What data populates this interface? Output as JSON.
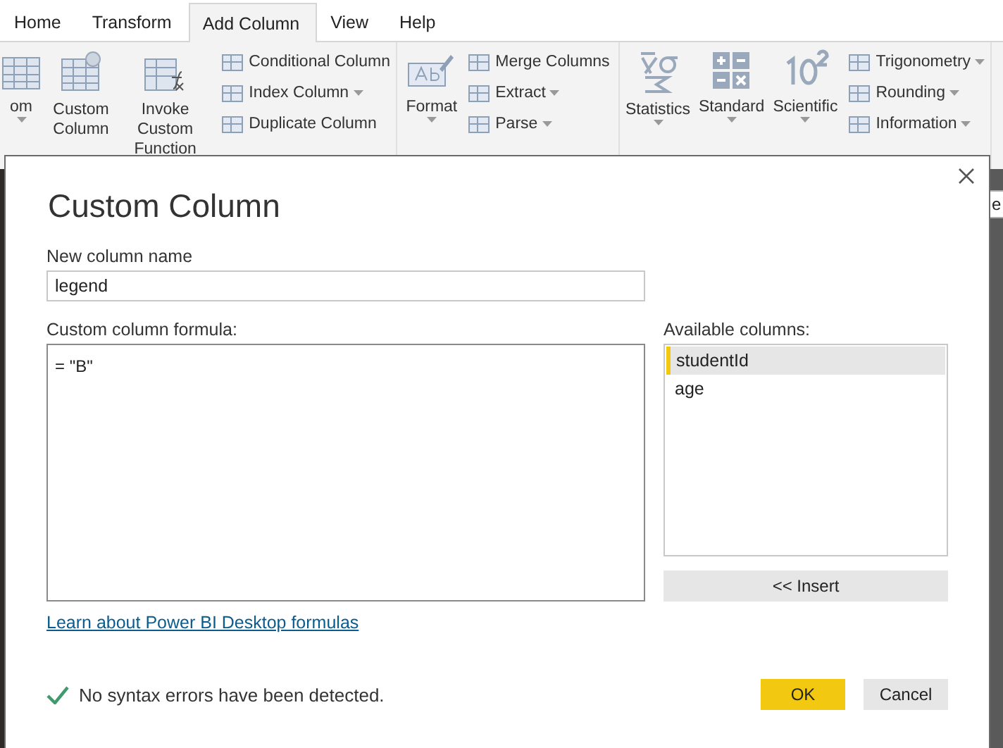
{
  "tabs": [
    {
      "label": "Home",
      "selected": false
    },
    {
      "label": "Transform",
      "selected": false
    },
    {
      "label": "Add Column",
      "selected": true
    },
    {
      "label": "View",
      "selected": false
    },
    {
      "label": "Help",
      "selected": false
    }
  ],
  "ribbon": {
    "groups": [
      {
        "items": [
          {
            "kind": "large",
            "label": "om",
            "dropdown": true
          },
          {
            "kind": "large",
            "label": "Custom Column",
            "dropdown": false
          },
          {
            "kind": "large",
            "label": "Invoke Custom Function",
            "dropdown": false
          },
          {
            "kind": "small",
            "label": "Conditional Column",
            "dropdown": false
          },
          {
            "kind": "small",
            "label": "Index Column",
            "dropdown": true
          },
          {
            "kind": "small",
            "label": "Duplicate Column",
            "dropdown": false
          }
        ]
      },
      {
        "items": [
          {
            "kind": "large",
            "label": "Format",
            "dropdown": true
          },
          {
            "kind": "small",
            "label": "Merge Columns",
            "dropdown": false
          },
          {
            "kind": "small",
            "label": "Extract",
            "dropdown": true
          },
          {
            "kind": "small",
            "label": "Parse",
            "dropdown": true
          }
        ]
      },
      {
        "items": [
          {
            "kind": "large",
            "label": "Statistics",
            "dropdown": true
          },
          {
            "kind": "large",
            "label": "Standard",
            "dropdown": true
          },
          {
            "kind": "large",
            "label": "Scientific",
            "dropdown": true
          },
          {
            "kind": "small",
            "label": "Trigonometry",
            "dropdown": true
          },
          {
            "kind": "small",
            "label": "Rounding",
            "dropdown": true
          },
          {
            "kind": "small",
            "label": "Information",
            "dropdown": true
          }
        ]
      }
    ]
  },
  "side_field": {
    "value": "e"
  },
  "dialog": {
    "title": "Custom Column",
    "name_label": "New column name",
    "name_value": "legend",
    "formula_label": "Custom column formula:",
    "formula": "= \"B\"",
    "columns_label": "Available columns:",
    "columns": [
      {
        "label": "studentId",
        "selected": true
      },
      {
        "label": "age",
        "selected": false
      }
    ],
    "insert_button": "<< Insert",
    "link": "Learn about Power BI Desktop formulas",
    "status": "No syntax errors have been detected.",
    "buttons": [
      {
        "label": "OK",
        "kind": "primary"
      },
      {
        "label": "Cancel",
        "kind": "secondary"
      }
    ]
  }
}
